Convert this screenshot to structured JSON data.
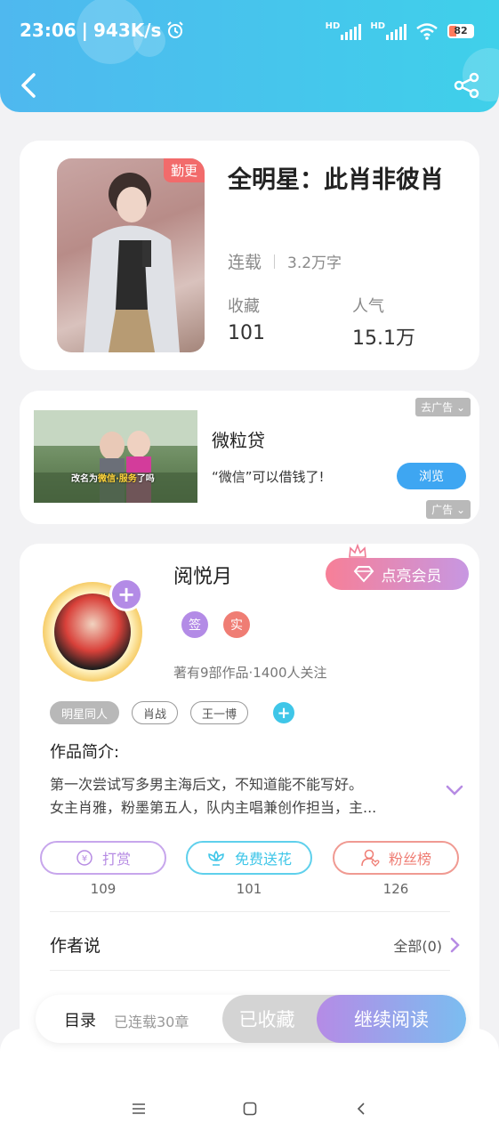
{
  "status_bar": {
    "time": "23:06",
    "speed": "943K/s",
    "battery": "82",
    "signal_label": "HD"
  },
  "book": {
    "tag": "勤更",
    "title": "全明星：此肖非彼肖",
    "status": "连载",
    "word_count": "3.2万字",
    "favorites_label": "收藏",
    "favorites_value": "101",
    "popularity_label": "人气",
    "popularity_value": "15.1万"
  },
  "ad": {
    "close_label": "去广告",
    "title": "微粒贷",
    "desc": "“微信”可以借钱了!",
    "browse_label": "浏览",
    "ad_label": "广告",
    "image_caption_prefix": "改名为",
    "image_caption_highlight": "微信·服务",
    "image_caption_suffix": "了吗"
  },
  "author": {
    "name": "阅悦月",
    "vip_label": "点亮会员",
    "badge_sign": "签",
    "badge_real": "实",
    "meta": "著有9部作品·1400人关注",
    "tags": [
      "明星同人",
      "肖战",
      "王一博"
    ],
    "intro_title": "作品简介:",
    "intro_text": "第一次尝试写多男主海后文，不知道能不能写好。\n女主肖雅，粉墨第五人，队内主唱兼创作担当，主..."
  },
  "actions": {
    "reward_label": "打赏",
    "reward_count": "109",
    "flower_label": "免费送花",
    "flower_count": "101",
    "fans_label": "粉丝榜",
    "fans_count": "126"
  },
  "author_says": {
    "title": "作者说",
    "all_label": "全部(0)"
  },
  "bottom_bar": {
    "toc_label": "目录",
    "serial_label": "已连载30章",
    "collected_label": "已收藏",
    "continue_label": "继续阅读"
  },
  "colors": {
    "header_start": "#4fb8ef",
    "header_end": "#3fd0ea",
    "reward": "#b68be3",
    "flower": "#3fc6e8",
    "fans": "#ef7d74"
  }
}
